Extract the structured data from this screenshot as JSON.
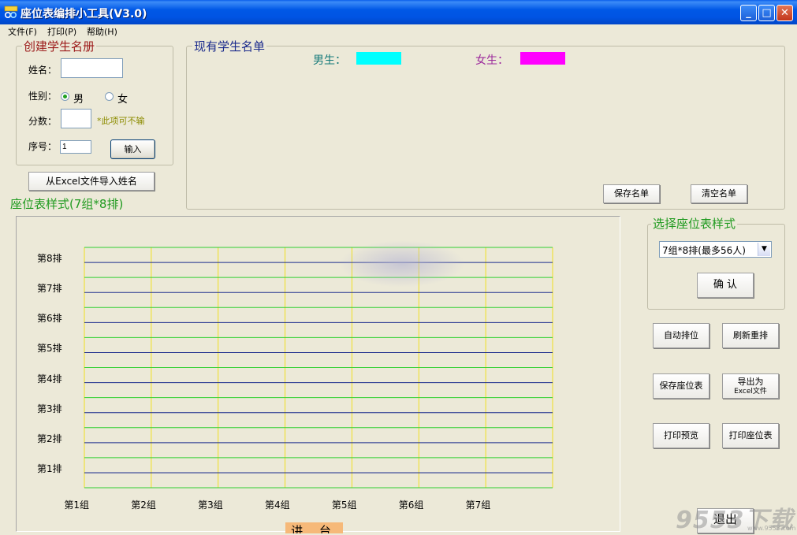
{
  "window": {
    "title": "座位表编排小工具(V3.0)",
    "controls": {
      "minimize": "_",
      "maximize": "□",
      "close": "✕"
    }
  },
  "menu": [
    "文件(F)",
    "打印(P)",
    "帮助(H)"
  ],
  "create_roster": {
    "title": "创建学生名册",
    "name_label": "姓名：",
    "name_value": "",
    "gender_label": "性别：",
    "gender_options": [
      "男",
      "女"
    ],
    "gender_selected": "男",
    "score_label": "分数：",
    "score_value": "",
    "score_hint": "*此项可不输",
    "serial_label": "序号：",
    "serial_value": "1",
    "enter_button": "输入"
  },
  "import_button": "从Excel文件导入姓名",
  "current_roster": {
    "title": "现有学生名单",
    "male_label": "男生：",
    "female_label": "女生：",
    "male_color": "#00FFFF",
    "female_color": "#FF00FF",
    "save_button": "保存名单",
    "clear_button": "清空名单"
  },
  "seat_style_title": "座位表样式(7组*8排)",
  "seat_grid": {
    "rows": [
      "第8排",
      "第7排",
      "第6排",
      "第5排",
      "第4排",
      "第3排",
      "第2排",
      "第1排"
    ],
    "groups": [
      "第1组",
      "第2组",
      "第3组",
      "第4组",
      "第5组",
      "第6组",
      "第7组"
    ],
    "lectern": "讲 台"
  },
  "choose_style": {
    "title": "选择座位表样式",
    "selected": "7组*8排(最多56人)",
    "confirm_button": "确 认"
  },
  "actions": {
    "auto_seat": "自动排位",
    "refresh": "刷新重排",
    "save_seat": "保存座位表",
    "export_excel_line1": "导出为",
    "export_excel_line2": "Excel文件",
    "print_preview": "打印预览",
    "print_seat": "打印座位表",
    "exit": "退出"
  },
  "watermark": {
    "text": "9553下载",
    "sub": "www.9553.com"
  }
}
